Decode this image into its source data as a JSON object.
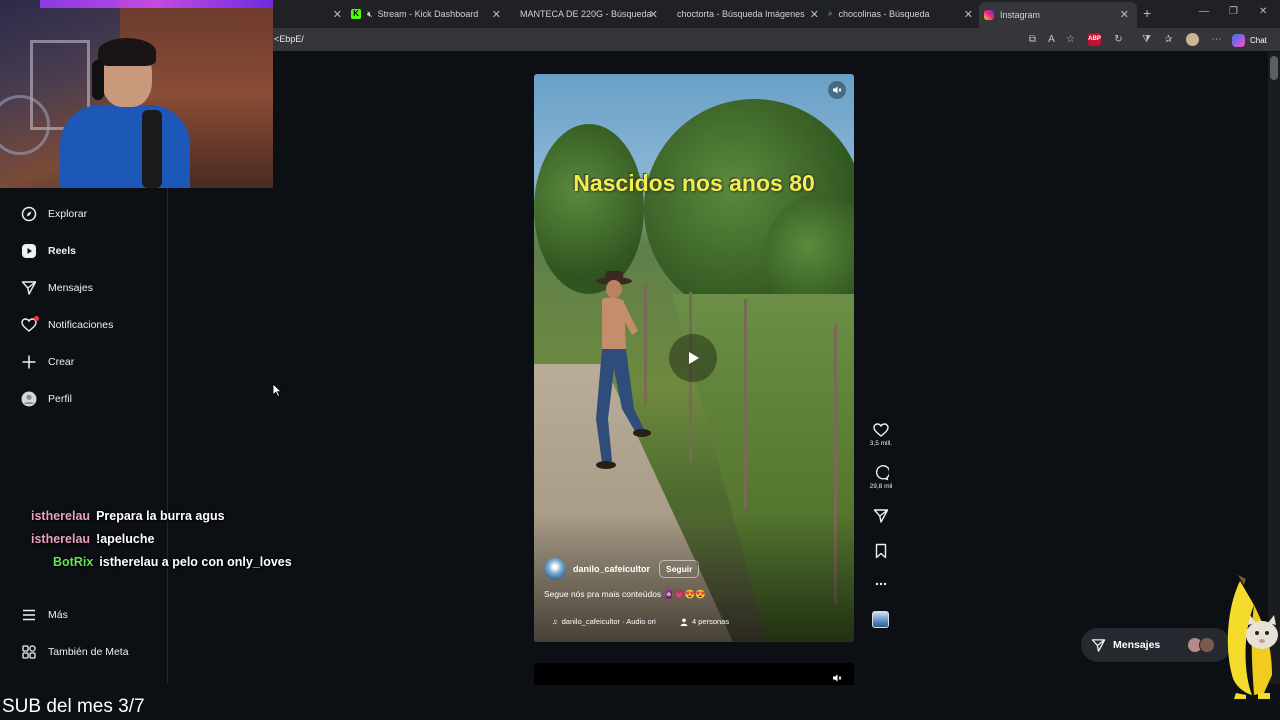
{
  "browser": {
    "tabs": [
      {
        "title": "",
        "favicon": "blank"
      },
      {
        "title": "Stream - Kick Dashboard",
        "favicon": "kick-icon",
        "muted": true
      },
      {
        "title": "MANTECA DE 220G - Búsqueda",
        "favicon": "search-icon"
      },
      {
        "title": "choctorta - Búsqueda Imágenes",
        "favicon": "search-icon"
      },
      {
        "title": "chocolinas - Búsqueda",
        "favicon": "search-icon"
      },
      {
        "title": "Instagram",
        "favicon": "instagram-icon",
        "active": true
      }
    ],
    "url": "<EbpE/",
    "chat_label": "Chat"
  },
  "sidebar": {
    "items": [
      {
        "label": "Explorar",
        "icon": "compass-icon"
      },
      {
        "label": "Reels",
        "icon": "reels-icon",
        "active": true
      },
      {
        "label": "Mensajes",
        "icon": "send-icon"
      },
      {
        "label": "Notificaciones",
        "icon": "heart-icon",
        "badge": true
      },
      {
        "label": "Crear",
        "icon": "plus-icon"
      },
      {
        "label": "Perfil",
        "icon": "avatar-icon"
      }
    ],
    "more": {
      "label": "Más",
      "icon": "menu-icon"
    },
    "meta": {
      "label": "También de Meta",
      "icon": "grid-icon"
    }
  },
  "stream_chat": [
    {
      "user": "istherelau",
      "message": "Prepara la burra agus",
      "user_color": "#e8a2c0"
    },
    {
      "user": "istherelau",
      "message": "!apeluche",
      "user_color": "#e8a2c0"
    },
    {
      "user": "BotRix",
      "message": "istherelau a pelo con only_loves",
      "user_color": "#5ee84c"
    }
  ],
  "reel": {
    "overlay_text": "Nascidos nos anos 80",
    "author": "danilo_cafeicultor",
    "follow_label": "Seguir",
    "caption": "Segue nós pra mais conteúdos 🧕🏼💗😍😍",
    "audio": "danilo_cafeicultor · Audio ori",
    "people": "4 personas",
    "likes": "3,5 mill.",
    "comments": "29,8 mil"
  },
  "messages_pill": {
    "label": "Mensajes"
  },
  "overlay_footer": "SUB del mes 3/7",
  "colors": {
    "accent": "#f1f04a",
    "background": "#0c0f14",
    "kick_green": "#53fc18",
    "notif_red": "#ff3040"
  }
}
